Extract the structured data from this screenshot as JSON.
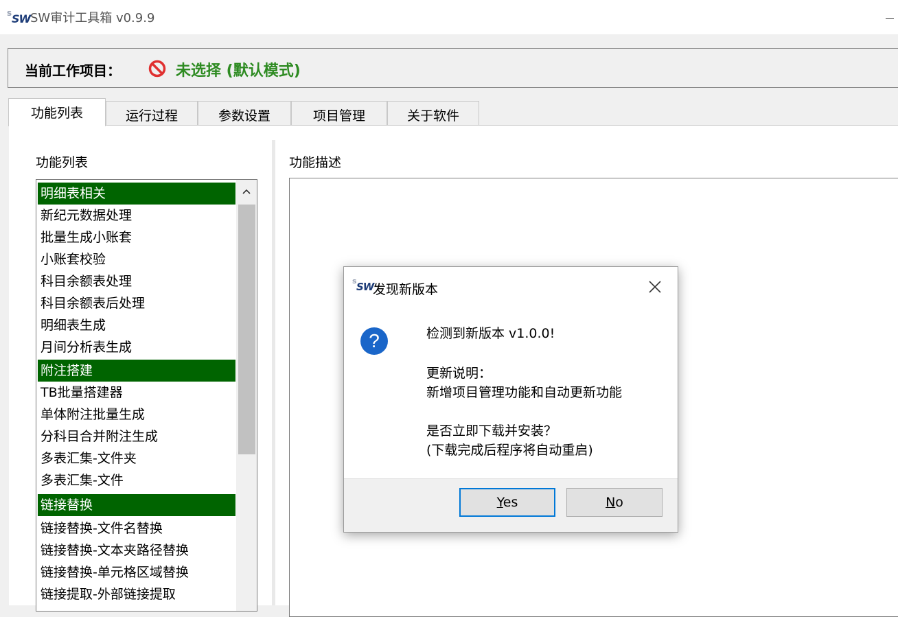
{
  "window": {
    "title": "SW审计工具箱 v0.9.9",
    "logo_s": "s",
    "logo_w": "SW"
  },
  "project": {
    "label": "当前工作项目：",
    "status": "未选择 (默认模式)",
    "status_color": "#2e8b22"
  },
  "tabs": [
    {
      "label": "功能列表",
      "active": true
    },
    {
      "label": "运行过程",
      "active": false
    },
    {
      "label": "参数设置",
      "active": false
    },
    {
      "label": "项目管理",
      "active": false
    },
    {
      "label": "关于软件",
      "active": false
    }
  ],
  "function_list": {
    "title": "功能列表",
    "header_color": "#006400",
    "items": [
      {
        "label": "明细表相关",
        "header": true
      },
      {
        "label": "新纪元数据处理",
        "header": false
      },
      {
        "label": "批量生成小账套",
        "header": false
      },
      {
        "label": "小账套校验",
        "header": false
      },
      {
        "label": "科目余额表处理",
        "header": false
      },
      {
        "label": "科目余额表后处理",
        "header": false
      },
      {
        "label": "明细表生成",
        "header": false
      },
      {
        "label": "月间分析表生成",
        "header": false
      },
      {
        "label": "附注搭建",
        "header": true
      },
      {
        "label": "TB批量搭建器",
        "header": false
      },
      {
        "label": "单体附注批量生成",
        "header": false
      },
      {
        "label": "分科目合并附注生成",
        "header": false
      },
      {
        "label": "多表汇集-文件夹",
        "header": false
      },
      {
        "label": "多表汇集-文件",
        "header": false
      },
      {
        "label": "链接替换",
        "header": true
      },
      {
        "label": "链接替换-文件名替换",
        "header": false
      },
      {
        "label": "链接替换-文本夹路径替换",
        "header": false
      },
      {
        "label": "链接替换-单元格区域替换",
        "header": false
      },
      {
        "label": "链接提取-外部链接提取",
        "header": false
      }
    ]
  },
  "function_desc": {
    "title": "功能描述"
  },
  "dialog": {
    "title": "发现新版本",
    "line1": "检测到新版本 v1.0.0!",
    "line2": "更新说明：",
    "line3": "新增项目管理功能和自动更新功能",
    "line4": "是否立即下载并安装？",
    "line5": "(下载完成后程序将自动重启)",
    "yes_mnemonic": "Y",
    "yes_rest": "es",
    "no_mnemonic": "N",
    "no_rest": "o",
    "icon_color": "#1a66c9"
  }
}
